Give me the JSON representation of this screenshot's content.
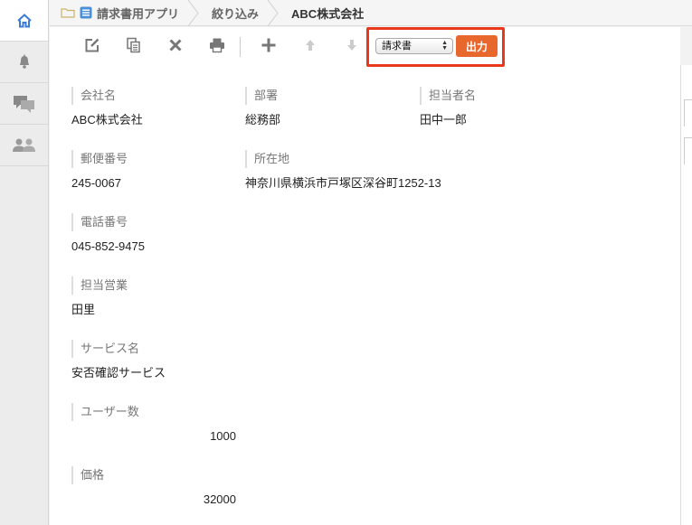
{
  "breadcrumb": {
    "app": "請求書用アプリ",
    "filter": "絞り込み",
    "record": "ABC株式会社"
  },
  "toolbar": {
    "export_select_value": "請求書",
    "export_button": "出力"
  },
  "fields": {
    "company_label": "会社名",
    "company_value": "ABC株式会社",
    "dept_label": "部署",
    "dept_value": "総務部",
    "person_label": "担当者名",
    "person_value": "田中一郎",
    "zip_label": "郵便番号",
    "zip_value": "245-0067",
    "address_label": "所在地",
    "address_value": "神奈川県横浜市戸塚区深谷町1252-13",
    "phone_label": "電話番号",
    "phone_value": "045-852-9475",
    "sales_label": "担当営業",
    "sales_value": "田里",
    "service_label": "サービス名",
    "service_value": "安否確認サービス",
    "users_label": "ユーザー数",
    "users_value": "1000",
    "price_label": "価格",
    "price_value": "32000"
  },
  "colors": {
    "accent": "#e8672d",
    "highlight_border": "#e8391b",
    "home_icon": "#3a7bd5"
  },
  "icons": {
    "rail": [
      "home-icon",
      "bell-icon",
      "comments-icon",
      "people-icon"
    ],
    "toolbar": [
      "edit-icon",
      "copy-icon",
      "delete-icon",
      "print-icon",
      "add-icon",
      "up-arrow-icon",
      "down-arrow-icon"
    ]
  }
}
